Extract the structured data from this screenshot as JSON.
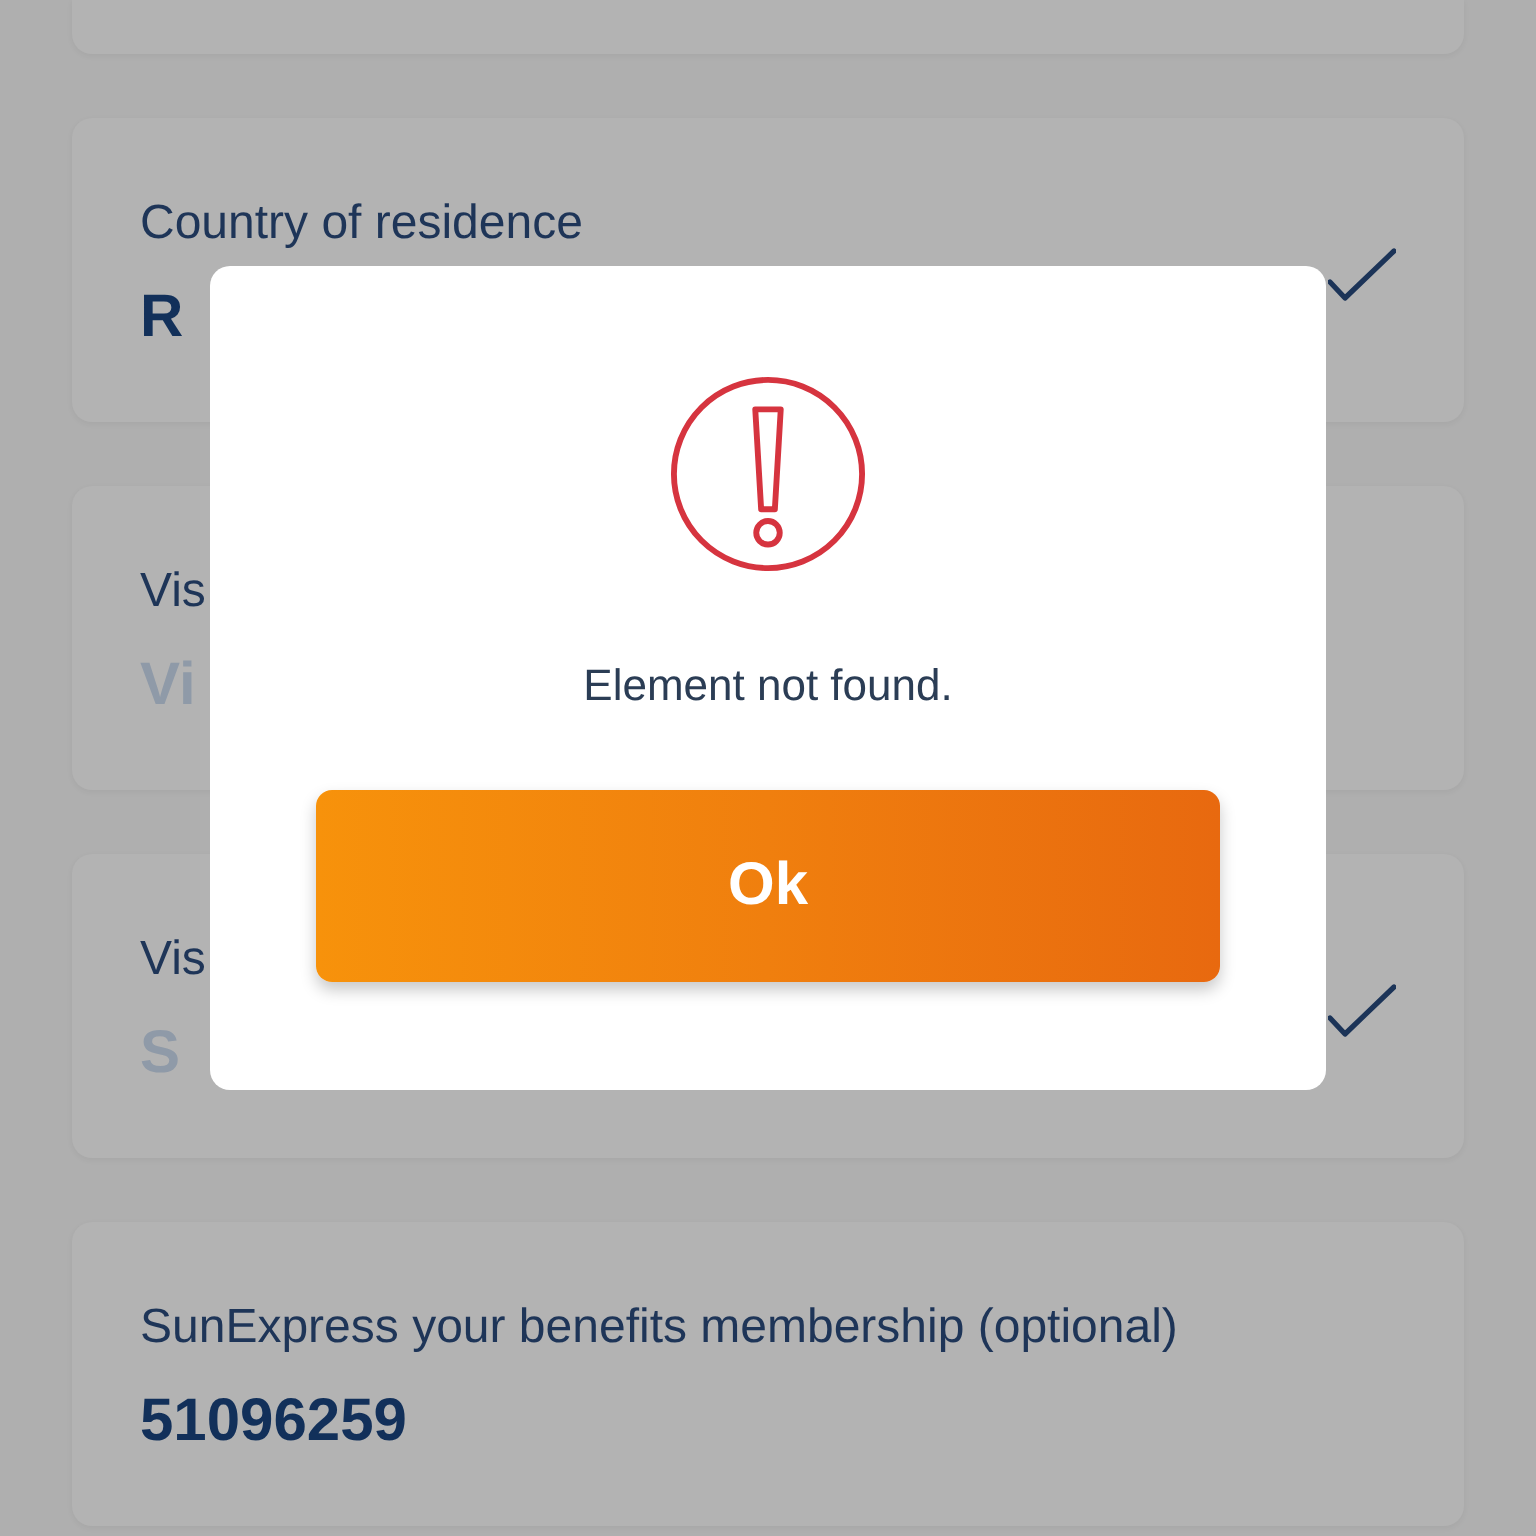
{
  "fields": [
    {
      "label": "Country of residence",
      "value": "R",
      "checked": true
    },
    {
      "label": "Vis",
      "placeholder": "Vi",
      "checked": false
    },
    {
      "label": "Vis",
      "placeholder": "S",
      "checked": true
    },
    {
      "label": "SunExpress your benefits membership (optional)",
      "value": "51096259",
      "checked": false
    }
  ],
  "dialog": {
    "message": "Element not found.",
    "button": "Ok"
  }
}
